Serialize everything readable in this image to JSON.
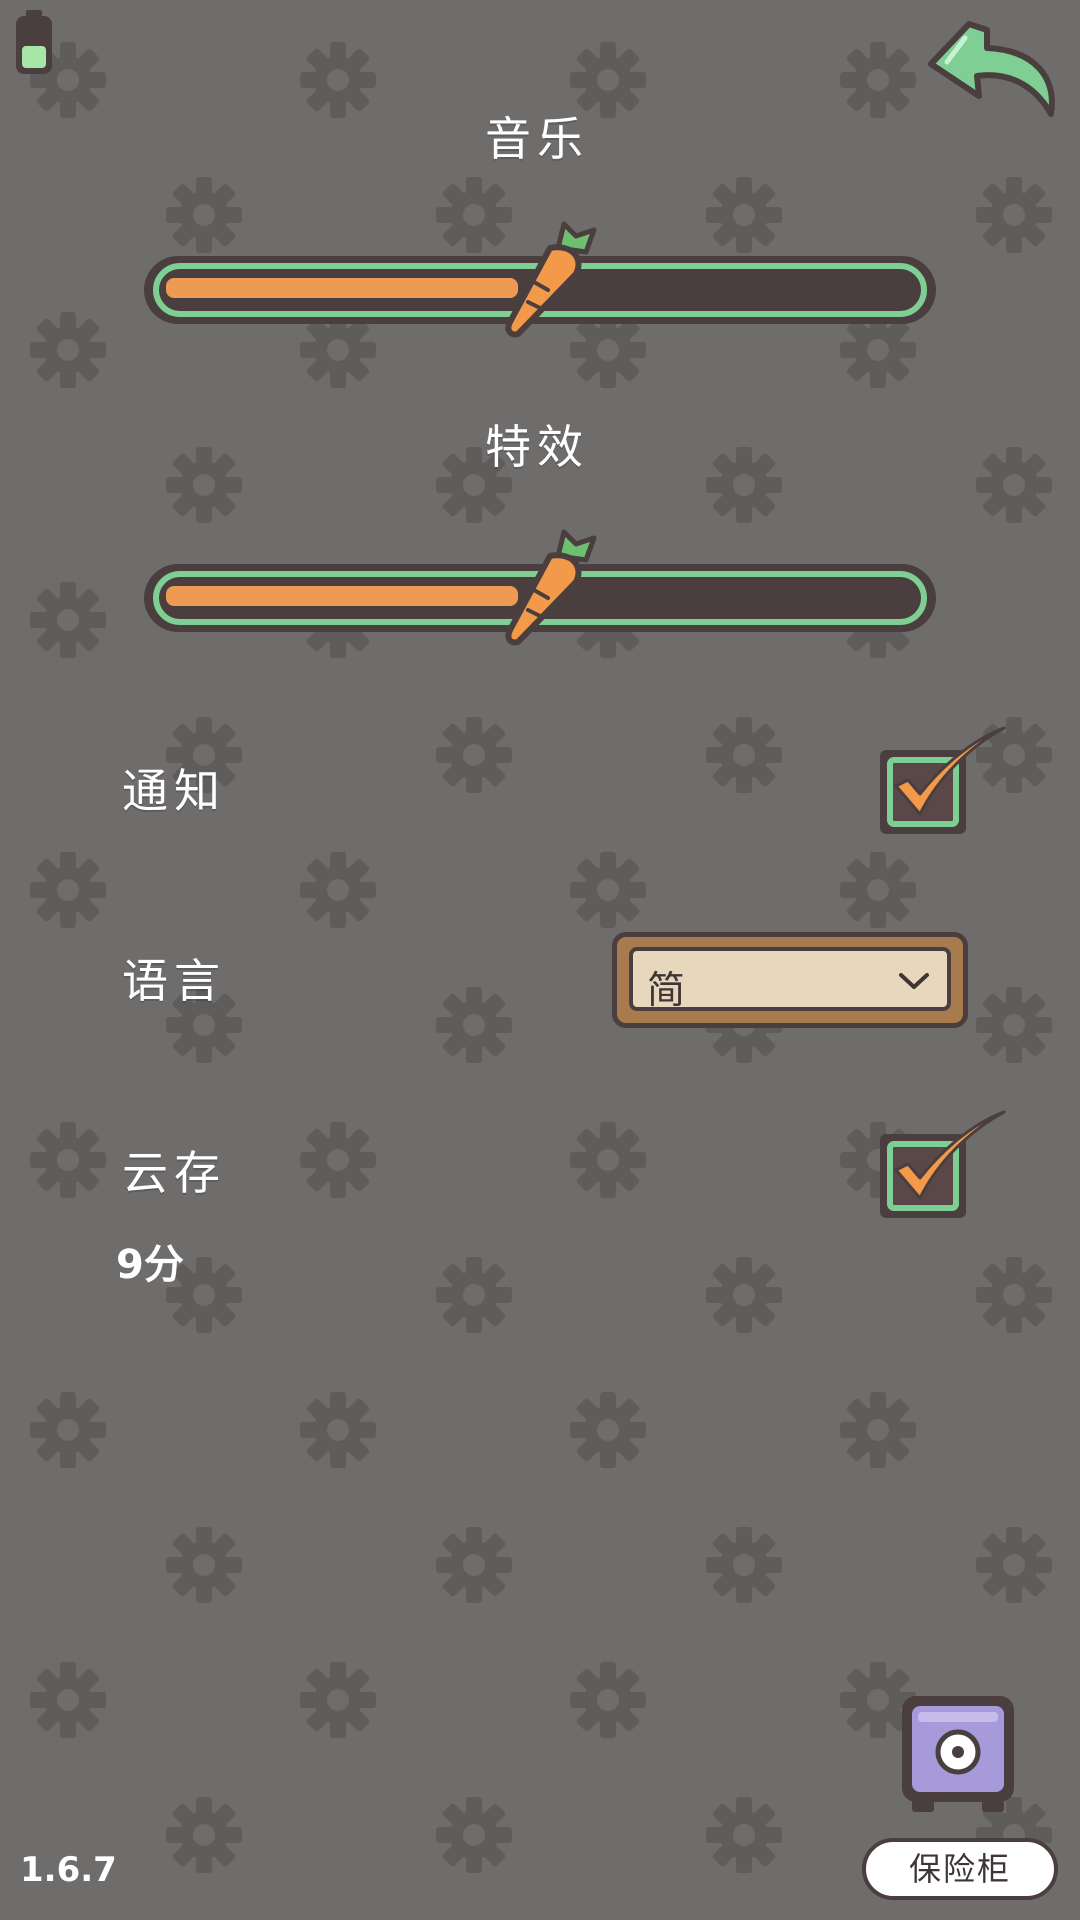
{
  "settings": {
    "music": {
      "label": "音乐",
      "level": 0.47
    },
    "effects": {
      "label": "特效",
      "level": 0.47
    },
    "notification": {
      "label": "通知",
      "checked": true
    },
    "language": {
      "label": "语言",
      "value": "简"
    },
    "cloud_save": {
      "label": "云存",
      "checked": true,
      "detail": "9分"
    }
  },
  "footer": {
    "version": "1.6.7",
    "vault_label": "保险柜"
  },
  "icons": {
    "back": "back-arrow-icon",
    "battery": "battery-icon",
    "slider_thumb": "carrot-icon",
    "vault": "safe-icon",
    "background": "gear-icon"
  },
  "colors": {
    "background": "#6f6c6c",
    "gear": "#5f5c5c",
    "outline": "#4a3e3e",
    "accent_green": "#7fcf95",
    "slider_fill": "#ef9a52",
    "check_orange": "#f2994a",
    "dropdown_frame": "#a77b4d",
    "dropdown_bg": "#e7d7bc",
    "vault_purple": "#a79adb"
  }
}
